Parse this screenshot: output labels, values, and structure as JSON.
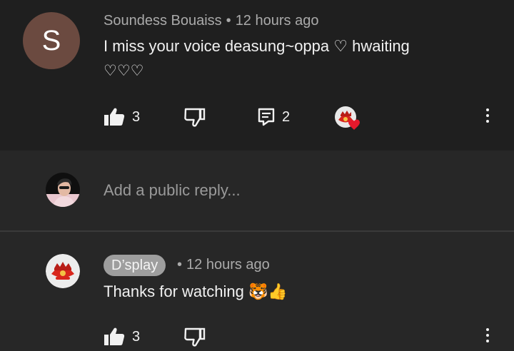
{
  "comment": {
    "avatar_letter": "S",
    "author": "Soundess Bouaiss",
    "separator": "•",
    "time": "12 hours ago",
    "text_line1": "I miss your voice deasung~oppa ♡ hwaiting",
    "text_line2": "♡♡♡",
    "likes": "3",
    "replies": "2"
  },
  "reply_box": {
    "placeholder": "Add a public reply..."
  },
  "reply": {
    "author": "D’splay",
    "separator": "•",
    "time": "12 hours ago",
    "text": "Thanks for watching",
    "emoji1": "🐯",
    "emoji2": "👍",
    "likes": "3"
  },
  "colors": {
    "background": "#1f1f1f",
    "reply_background": "#272727",
    "avatar_s": "#6b4a40",
    "heart": "#e5192c",
    "author_badge": "#9e9e9e"
  }
}
